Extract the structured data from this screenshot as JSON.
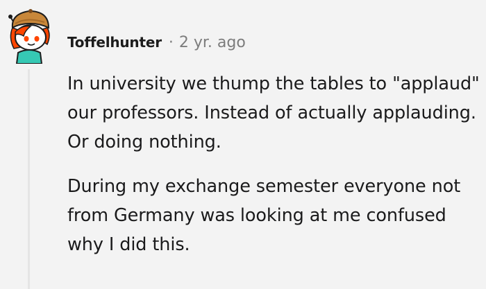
{
  "comment": {
    "username": "Toffelhunter",
    "separator": "·",
    "timestamp": "2 yr. ago",
    "avatar_icon": "snoo-avatar-icon",
    "paragraphs": [
      "In university we thump the tables to \"applaud\" our professors. Instead of actually applauding. Or doing nothing.",
      "During my exchange semester everyone not from Germany was looking at me confused why I did this."
    ]
  },
  "colors": {
    "background": "#f3f3f3",
    "text": "#1a1a1b",
    "meta": "#7c7c7c",
    "avatar_hat": "#c8873a",
    "avatar_hair": "#ff4500",
    "avatar_shirt": "#36c9b4"
  }
}
